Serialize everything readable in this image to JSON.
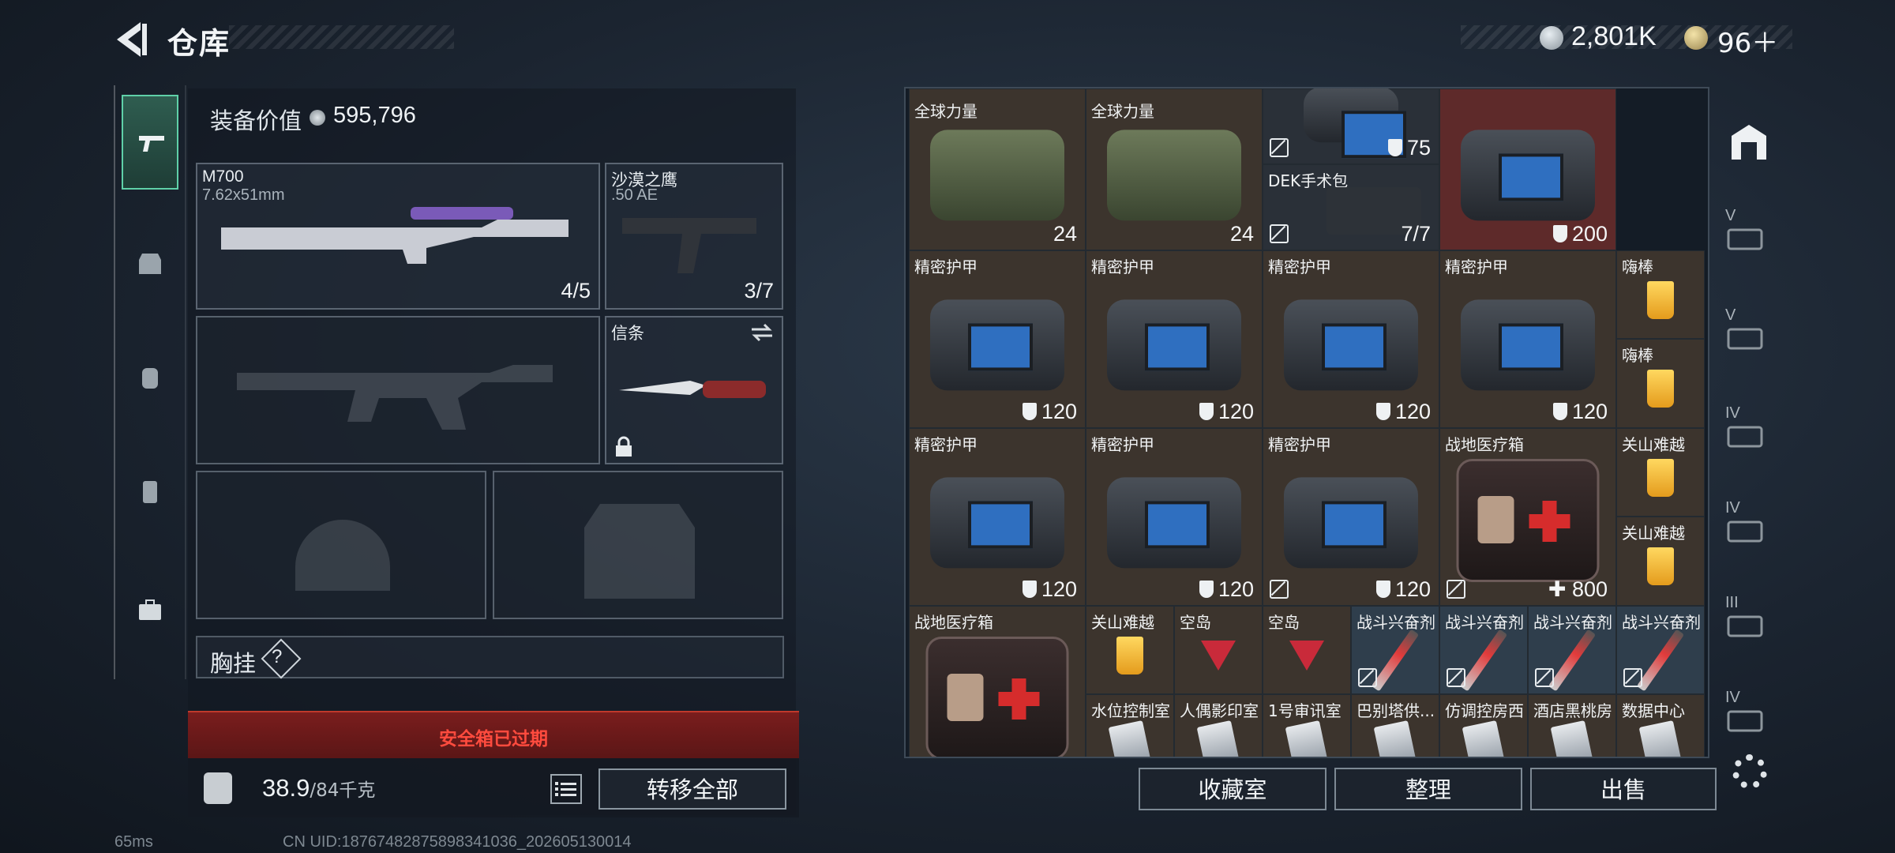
{
  "header": {
    "title": "仓库",
    "money": "2,801K",
    "tokens": "96＋"
  },
  "equipment": {
    "value_label": "装备价值",
    "value": "595,796",
    "slots": [
      {
        "name": "M700",
        "sub": "7.62x51mm",
        "count": "4/5"
      },
      {
        "name": "沙漠之鹰",
        "sub": ".50 AE",
        "count": "3/7"
      },
      {
        "name": "信条",
        "sub": "",
        "count": ""
      }
    ],
    "chest_label": "胸挂",
    "chest_hint": "?"
  },
  "safebox": {
    "expired_text": "安全箱已过期"
  },
  "weight": {
    "current": "38.9",
    "max": "/84千克"
  },
  "buttons": {
    "transfer_all": "转移全部",
    "collection": "收藏室",
    "sort": "整理",
    "sell": "出售"
  },
  "status": {
    "ping": "65ms",
    "uid": "CN UID:18767482875898341036_202605130014"
  },
  "grid": {
    "row0": [
      {
        "name": "全球力量",
        "value": "24"
      },
      {
        "name": "全球力量",
        "value": "24"
      },
      {
        "name": "",
        "value": "75"
      },
      {
        "name": "DEK手术包",
        "value": "7/7"
      },
      {
        "name": "",
        "value": "200"
      }
    ],
    "row1": [
      {
        "name": "精密护甲",
        "value": "120"
      },
      {
        "name": "精密护甲",
        "value": "120"
      },
      {
        "name": "精密护甲",
        "value": "120"
      },
      {
        "name": "精密护甲",
        "value": "120"
      },
      {
        "name": "嗨棒",
        "value": ""
      },
      {
        "name": "嗨棒",
        "value": ""
      }
    ],
    "row2": [
      {
        "name": "精密护甲",
        "value": "120"
      },
      {
        "name": "精密护甲",
        "value": "120"
      },
      {
        "name": "精密护甲",
        "value": "120"
      },
      {
        "name": "战地医疗箱",
        "value": "800"
      },
      {
        "name": "关山难越",
        "value": ""
      },
      {
        "name": "关山难越",
        "value": ""
      }
    ],
    "row3": [
      {
        "name": "战地医疗箱",
        "value": ""
      },
      {
        "name": "关山难越",
        "value": ""
      },
      {
        "name": "空岛",
        "value": ""
      },
      {
        "name": "空岛",
        "value": ""
      },
      {
        "name": "战斗兴奋剂",
        "value": ""
      },
      {
        "name": "战斗兴奋剂",
        "value": ""
      },
      {
        "name": "战斗兴奋剂",
        "value": ""
      },
      {
        "name": "战斗兴奋剂",
        "value": ""
      }
    ],
    "row4": [
      {
        "name": "水位控制室"
      },
      {
        "name": "人偶影印室"
      },
      {
        "name": "1号审讯室"
      },
      {
        "name": "巴别塔供..."
      },
      {
        "name": "仿调控房西"
      },
      {
        "name": "酒店黑桃房"
      },
      {
        "name": "数据中心"
      }
    ]
  },
  "right_rail": {
    "items": [
      "V",
      "V",
      "IV",
      "IV",
      "III",
      "IV"
    ]
  },
  "colors": {
    "accent": "#5fd0a8",
    "danger": "#ff4b3e"
  }
}
